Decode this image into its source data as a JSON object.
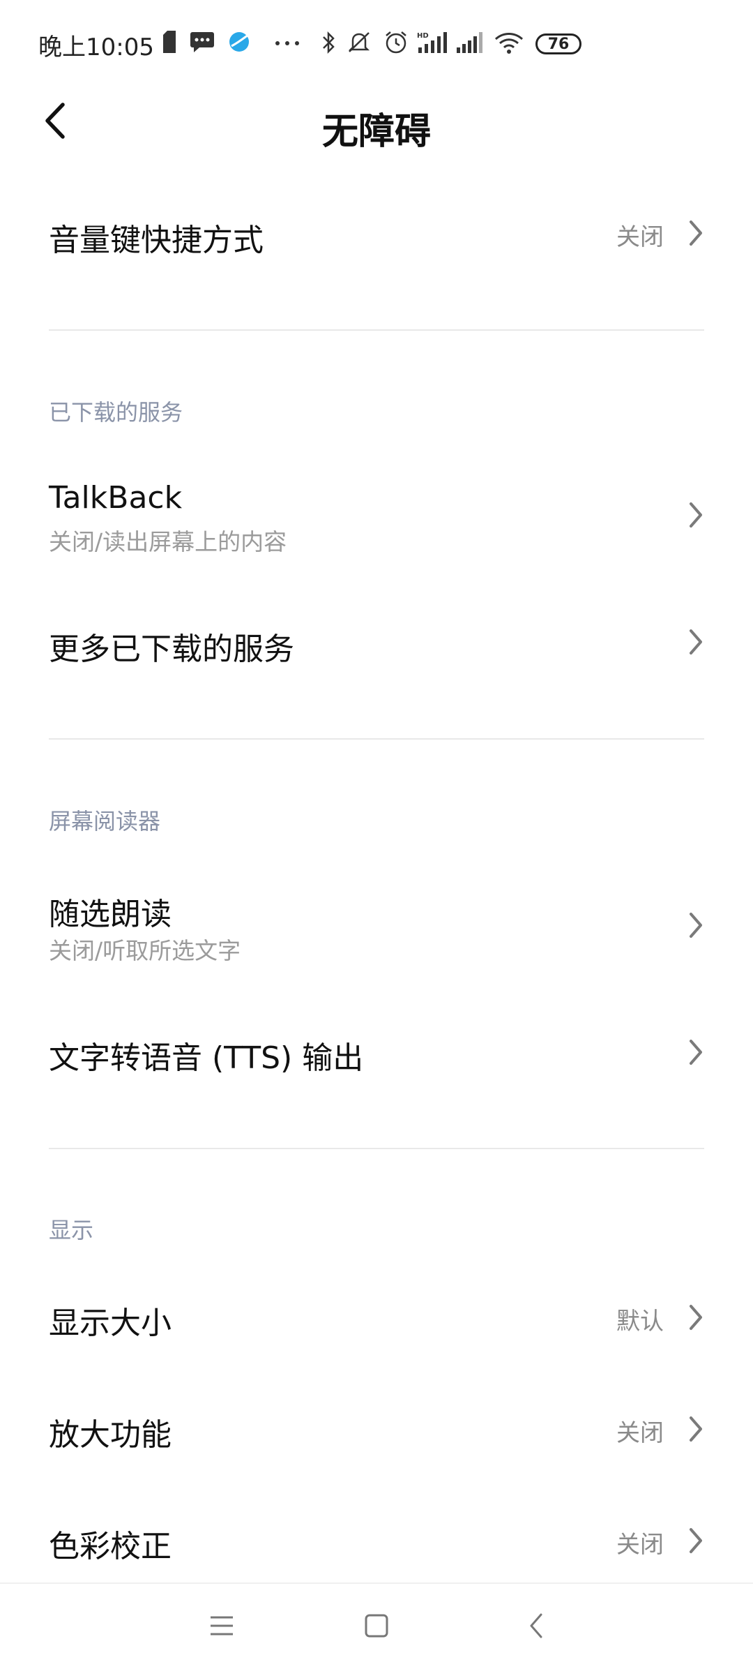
{
  "status_bar": {
    "time": "晚上10:05",
    "battery_level": "76",
    "icons": [
      "sim-card-icon",
      "message-icon",
      "app-notification-icon",
      "more-dots-icon",
      "bluetooth-icon",
      "mute-icon",
      "alarm-icon",
      "hd-signal-icon",
      "signal-icon",
      "wifi-icon",
      "battery-icon"
    ]
  },
  "header": {
    "title": "无障碍",
    "back_icon": "back-chevron-icon"
  },
  "items": {
    "volume_shortcut": {
      "title": "音量键快捷方式",
      "value": "关闭"
    },
    "talkback": {
      "title": "TalkBack",
      "subtitle": "关闭/读出屏幕上的内容"
    },
    "more_services": {
      "title": "更多已下载的服务"
    },
    "select_to_speak": {
      "title": "随选朗读",
      "subtitle": "关闭/听取所选文字"
    },
    "tts_output": {
      "title": "文字转语音 (TTS) 输出"
    },
    "display_size": {
      "title": "显示大小",
      "value": "默认"
    },
    "magnification": {
      "title": "放大功能",
      "value": "关闭"
    },
    "color_correction": {
      "title": "色彩校正",
      "value": "关闭"
    }
  },
  "sections": {
    "downloaded_services": "已下载的服务",
    "screen_readers": "屏幕阅读器",
    "display": "显示"
  },
  "nav_bar": {
    "icons": [
      "menu-icon",
      "home-icon",
      "back-icon"
    ]
  },
  "colors": {
    "section_header": "#8a93a8",
    "secondary_text": "#9b9b9b",
    "divider": "#e8e8e8"
  }
}
